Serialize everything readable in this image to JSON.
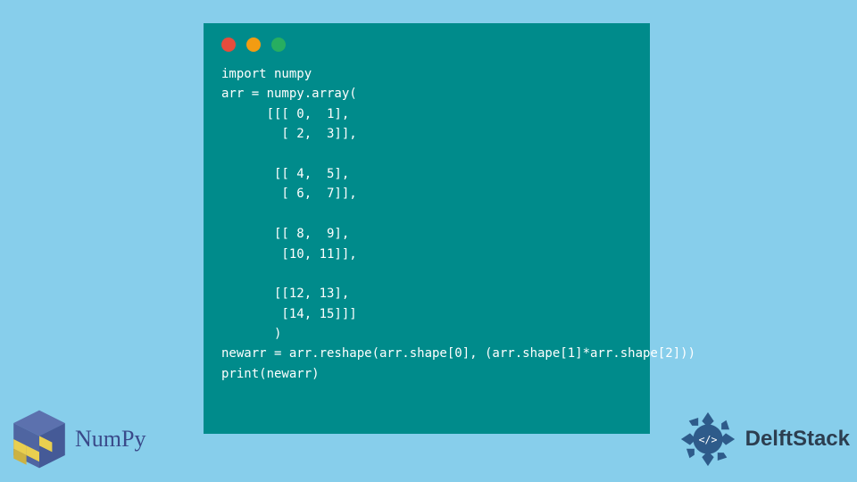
{
  "code": {
    "content": "import numpy\narr = numpy.array(\n      [[[ 0,  1],\n        [ 2,  3]],\n\n       [[ 4,  5],\n        [ 6,  7]],\n\n       [[ 8,  9],\n        [10, 11]],\n\n       [[12, 13],\n        [14, 15]]]\n       )\nnewarr = arr.reshape(arr.shape[0], (arr.shape[1]*arr.shape[2]))\nprint(newarr)"
  },
  "branding": {
    "numpy_label": "NumPy",
    "delft_label": "DelftStack"
  },
  "colors": {
    "background": "#87CEEB",
    "window_bg": "#008B8B",
    "dot_red": "#E74C3C",
    "dot_yellow": "#F39C12",
    "dot_green": "#27AE60",
    "numpy_text": "#3A4A8A",
    "delft_text": "#2C3E50"
  }
}
